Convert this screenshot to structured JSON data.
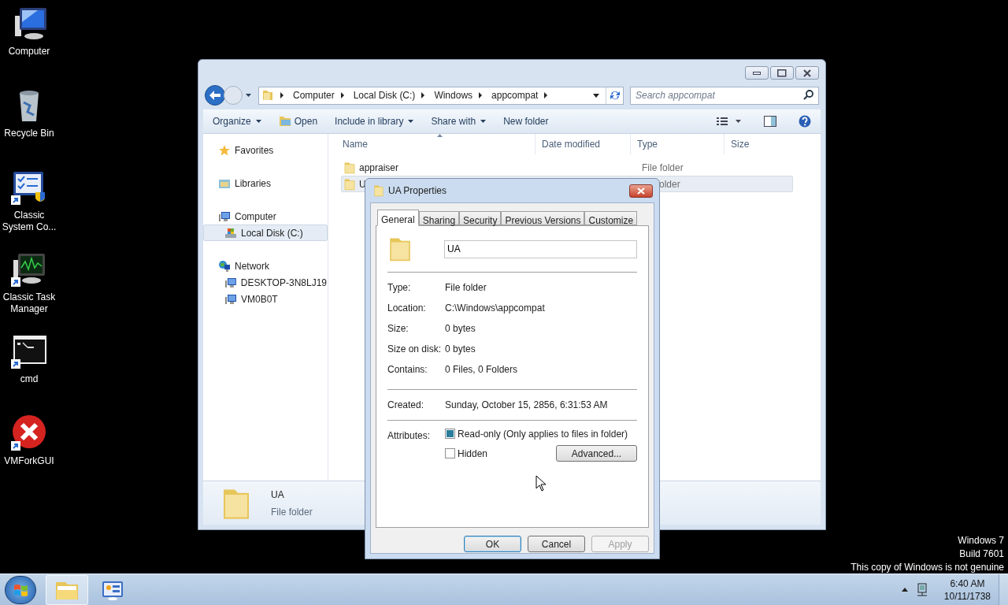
{
  "desktop_icons": [
    {
      "label": "Computer",
      "kind": "computer"
    },
    {
      "label": "Recycle Bin",
      "kind": "recycle"
    },
    {
      "label": "Classic System Co...",
      "kind": "control"
    },
    {
      "label": "Classic Task Manager",
      "kind": "taskmgr"
    },
    {
      "label": "cmd",
      "kind": "cmd"
    },
    {
      "label": "VMForkGUI",
      "kind": "error"
    }
  ],
  "explorer": {
    "address": [
      "Computer",
      "Local Disk (C:)",
      "Windows",
      "appcompat"
    ],
    "search": {
      "placeholder": "Search appcompat"
    },
    "toolbar": [
      {
        "label": "Organize",
        "dropdown": true,
        "kind": "menu"
      },
      {
        "label": "Open",
        "dropdown": false,
        "kind": "open"
      },
      {
        "label": "Include in library",
        "dropdown": true,
        "kind": "menu"
      },
      {
        "label": "Share with",
        "dropdown": true,
        "kind": "menu"
      },
      {
        "label": "New folder",
        "dropdown": false,
        "kind": "menu"
      }
    ],
    "nav": [
      {
        "label": "Favorites",
        "kind": "star",
        "selected": false
      },
      {
        "label": "Libraries",
        "kind": "library",
        "selected": false
      },
      {
        "label": "Computer",
        "kind": "computer",
        "selected": false,
        "children": [
          {
            "label": "Local Disk (C:)",
            "kind": "disk",
            "selected": true
          }
        ]
      },
      {
        "label": "Network",
        "kind": "network",
        "selected": false,
        "children": [
          {
            "label": "DESKTOP-3N8LJ19",
            "kind": "computer",
            "selected": false
          },
          {
            "label": "VM0B0T",
            "kind": "computer",
            "selected": false
          }
        ]
      }
    ],
    "columns": [
      "Name",
      "Date modified",
      "Type",
      "Size"
    ],
    "rows": [
      {
        "name": "appraiser",
        "type": "File folder",
        "selected": false
      },
      {
        "name": "U",
        "type": "older",
        "selected": true
      }
    ],
    "details": {
      "name": "UA",
      "type": "File folder"
    }
  },
  "dialog": {
    "title": "UA Properties",
    "tabs": [
      {
        "label": "General",
        "selected": true
      },
      {
        "label": "Sharing",
        "selected": false
      },
      {
        "label": "Security",
        "selected": false
      },
      {
        "label": "Previous Versions",
        "selected": false
      },
      {
        "label": "Customize",
        "selected": false
      }
    ],
    "name_value": "UA",
    "groups": [
      [
        {
          "label": "Type:",
          "value": "File folder"
        },
        {
          "label": "Location:",
          "value": "C:\\Windows\\appcompat"
        },
        {
          "label": "Size:",
          "value": "0 bytes"
        },
        {
          "label": "Size on disk:",
          "value": "0 bytes"
        },
        {
          "label": "Contains:",
          "value": "0 Files, 0 Folders"
        }
      ],
      [
        {
          "label": "Created:",
          "value": "Sunday, October 15, 2856, 6:31:53 AM"
        }
      ]
    ],
    "attributes_label": "Attributes:",
    "attributes": [
      {
        "label": "Read-only (Only applies to files in folder)",
        "checked": true
      },
      {
        "label": "Hidden",
        "checked": false
      }
    ],
    "advanced_button": "Advanced...",
    "buttons": [
      {
        "label": "OK",
        "disabled": false,
        "default": true
      },
      {
        "label": "Cancel",
        "disabled": false,
        "default": false
      },
      {
        "label": "Apply",
        "disabled": true,
        "default": false
      }
    ]
  },
  "genuine_notice": [
    "Windows 7",
    "Build 7601",
    "This copy of Windows is not genuine"
  ],
  "clock": {
    "time": "6:40 AM",
    "date": "10/11/1738"
  }
}
